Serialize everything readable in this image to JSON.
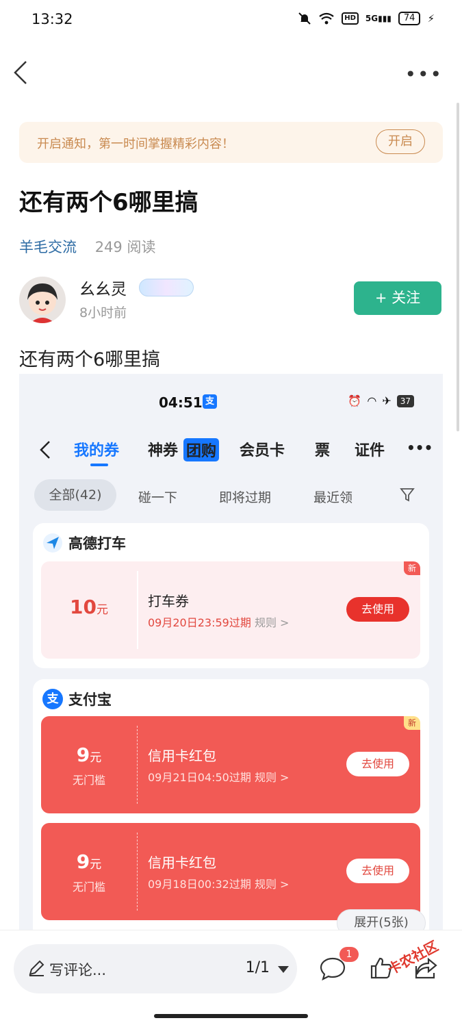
{
  "status_bar": {
    "time": "13:32",
    "network": "5G",
    "hd": "HD",
    "battery": "74"
  },
  "notify_banner": {
    "text": "开启通知，第一时间掌握精彩内容！",
    "button": "开启"
  },
  "post": {
    "title": "还有两个6哪里搞",
    "category": "羊毛交流",
    "reads": "249 阅读",
    "body": "还有两个6哪里搞"
  },
  "author": {
    "name": "幺幺灵",
    "time": "8小时前",
    "follow_label": "+ 关注"
  },
  "screenshot": {
    "status_time": "04:51",
    "status_app_glyph": "支",
    "battery": "37",
    "tabs": [
      {
        "label": "我的券",
        "active": true
      },
      {
        "label": "神券",
        "badge": "团购"
      },
      {
        "label": "会员卡"
      },
      {
        "label": "票"
      },
      {
        "label": "证件"
      }
    ],
    "filters": [
      "全部(42)",
      "碰一下",
      "即将过期",
      "最近领"
    ],
    "groups": [
      {
        "merchant": "高德打车",
        "coupons": [
          {
            "amount": "10",
            "unit": "元",
            "name": "打车券",
            "expiry": "09月20日23:59过期",
            "rule": "规则 >",
            "action": "去使用",
            "tag": "新"
          }
        ]
      },
      {
        "merchant": "支付宝",
        "coupons": [
          {
            "amount": "9",
            "unit": "元",
            "condition": "无门槛",
            "name": "信用卡红包",
            "expiry": "09月21日04:50过期",
            "rule": "规则 >",
            "action": "去使用",
            "tag": "新"
          },
          {
            "amount": "9",
            "unit": "元",
            "condition": "无门槛",
            "name": "信用卡红包",
            "expiry": "09月18日00:32过期",
            "rule": "规则 >",
            "action": "去使用"
          }
        ],
        "expand": "展开(5张)"
      }
    ]
  },
  "bottom_bar": {
    "comment_placeholder": "写评论...",
    "page_indicator": "1/1",
    "comment_count": "1"
  },
  "watermark": "卡农社区",
  "colors": {
    "accent_green": "#2db38d",
    "link_blue": "#2b6aa3",
    "alipay_blue": "#1677ff",
    "coupon_red": "#f25a55",
    "notify_orange": "#c98a50"
  }
}
